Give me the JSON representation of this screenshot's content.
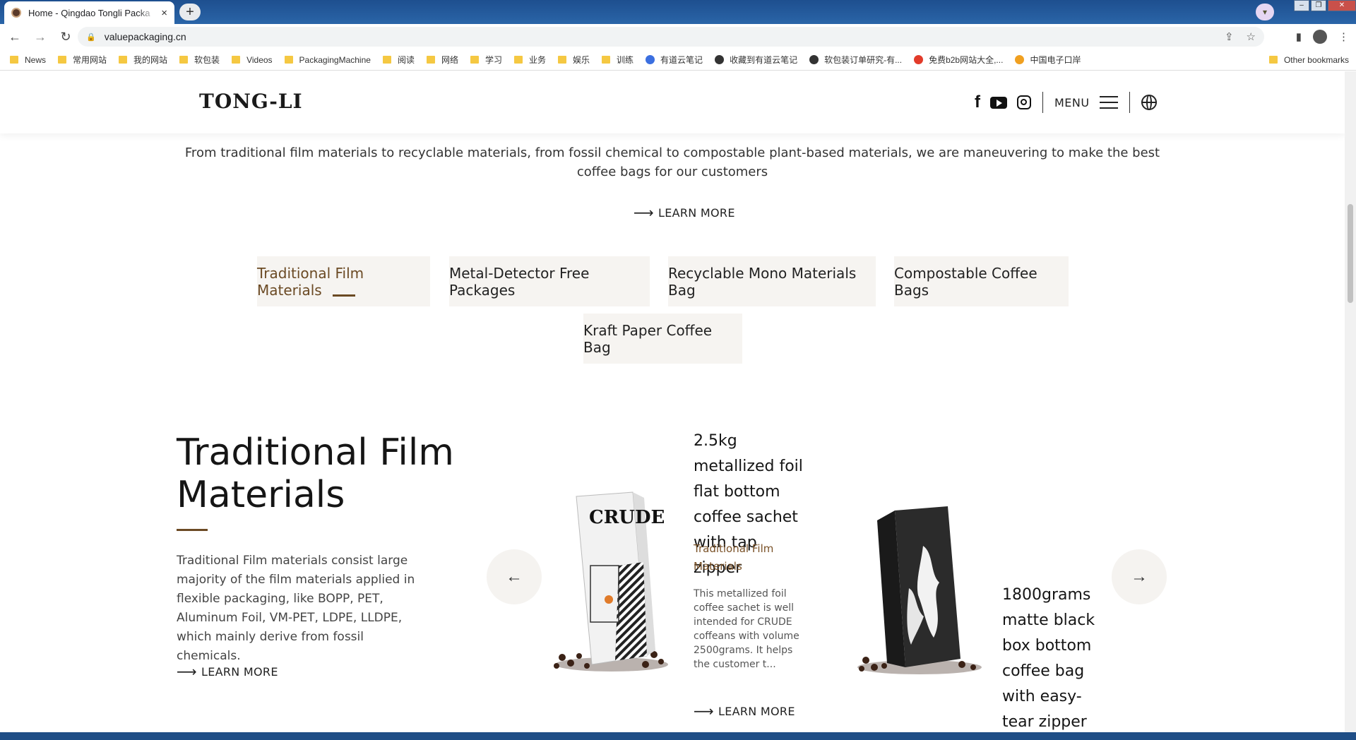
{
  "browser": {
    "tab_title": "Home - Qingdao Tongli Packa",
    "tab_close": "×",
    "new_tab": "+",
    "url": "valuepackaging.cn",
    "bookmarks": [
      {
        "label": "News",
        "kind": "folder"
      },
      {
        "label": "常用网站",
        "kind": "folder"
      },
      {
        "label": "我的网站",
        "kind": "folder"
      },
      {
        "label": "软包装",
        "kind": "folder"
      },
      {
        "label": "Videos",
        "kind": "folder"
      },
      {
        "label": "PackagingMachine",
        "kind": "folder"
      },
      {
        "label": "阅读",
        "kind": "folder"
      },
      {
        "label": "网络",
        "kind": "folder"
      },
      {
        "label": "学习",
        "kind": "folder"
      },
      {
        "label": "业务",
        "kind": "folder"
      },
      {
        "label": "娱乐",
        "kind": "folder"
      },
      {
        "label": "训练",
        "kind": "folder"
      },
      {
        "label": "有道云笔记",
        "kind": "site"
      },
      {
        "label": "收藏到有道云笔记",
        "kind": "site"
      },
      {
        "label": "软包装订单研究-有...",
        "kind": "site"
      },
      {
        "label": "免费b2b网站大全,...",
        "kind": "site"
      },
      {
        "label": "中国电子口岸",
        "kind": "site"
      }
    ],
    "other_bookmarks": "Other bookmarks"
  },
  "header": {
    "logo": "TONG-LI",
    "menu_label": "MENU"
  },
  "intro": {
    "text": "From traditional film materials to recyclable materials, from fossil chemical to compostable plant-based materials, we are maneuvering to make the best coffee bags for our customers",
    "learn_more": "LEARN MORE"
  },
  "category_tabs": [
    {
      "label": "Traditional Film Materials",
      "active": true
    },
    {
      "label": "Metal-Detector Free Packages",
      "active": false
    },
    {
      "label": "Recyclable Mono Materials Bag",
      "active": false
    },
    {
      "label": "Compostable Coffee Bags",
      "active": false
    },
    {
      "label": "Kraft Paper Coffee Bag",
      "active": false
    }
  ],
  "feature": {
    "title": "Traditional Film Materials",
    "description": "Traditional Film materials consist large majority of the film materials applied in flexible packaging, like BOPP, PET, Aluminum Foil, VM-PET, LDPE, LLDPE, which mainly derive from fossil chemicals.",
    "learn_more": "LEARN MORE"
  },
  "products": [
    {
      "title": "2.5kg metallized foil flat bottom coffee sachet with tap zipper",
      "category": "Traditional Film Materials",
      "description": "This metallized foil coffee sachet is well intended for CRUDE coffeans with volume 2500grams. It helps the customer t...",
      "learn_more": "LEARN MORE",
      "bag_text": "CRUDE"
    },
    {
      "title": "1800grams matte black box bottom coffee bag with easy-tear zipper"
    }
  ],
  "colors": {
    "accent": "#6b4a24",
    "tab_bg": "#f6f4f1"
  },
  "icons": {
    "prev": "←",
    "next": "→",
    "learn_arrow": "⟶"
  }
}
